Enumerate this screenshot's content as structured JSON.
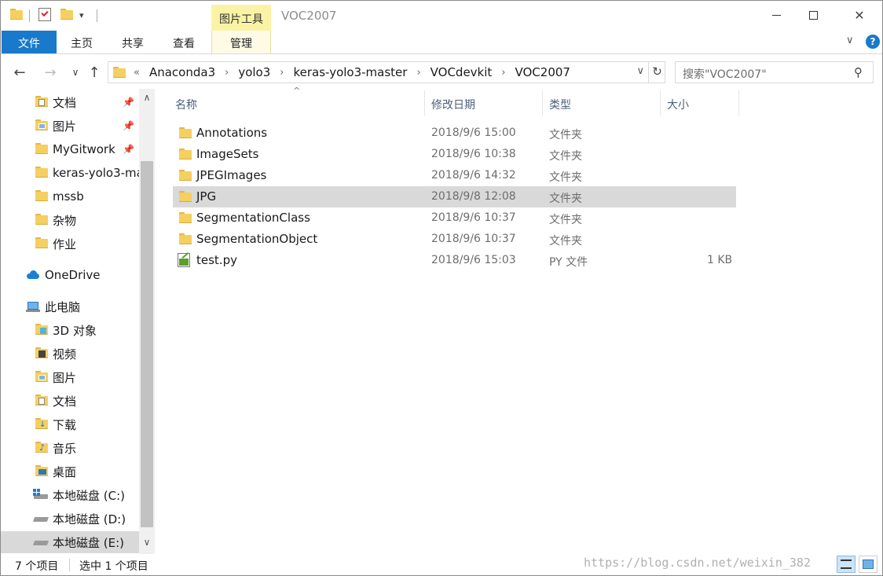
{
  "window": {
    "title": "VOC2007",
    "context_tab_group": "图片工具"
  },
  "ribbon": {
    "tabs": [
      {
        "label": "文件"
      },
      {
        "label": "主页"
      },
      {
        "label": "共享"
      },
      {
        "label": "查看"
      },
      {
        "label": "管理"
      }
    ]
  },
  "address": {
    "overflow": "«",
    "crumbs": [
      "Anaconda3",
      "yolo3",
      "keras-yolo3-master",
      "VOCdevkit",
      "VOC2007"
    ]
  },
  "search": {
    "placeholder": "搜索\"VOC2007\""
  },
  "sidebar": {
    "items": [
      {
        "label": "文档",
        "icon": "documents-icon",
        "pinned": true
      },
      {
        "label": "图片",
        "icon": "pictures-icon",
        "pinned": true
      },
      {
        "label": "MyGitwork",
        "icon": "folder-icon",
        "pinned": true
      },
      {
        "label": "keras-yolo3-ma",
        "icon": "folder-icon"
      },
      {
        "label": "mssb",
        "icon": "folder-icon"
      },
      {
        "label": "杂物",
        "icon": "folder-icon"
      },
      {
        "label": "作业",
        "icon": "folder-icon"
      },
      {
        "label": "OneDrive",
        "icon": "onedrive-icon"
      },
      {
        "label": "此电脑",
        "icon": "this-pc-icon"
      },
      {
        "label": "3D 对象",
        "icon": "3d-objects-icon"
      },
      {
        "label": "视频",
        "icon": "videos-icon"
      },
      {
        "label": "图片",
        "icon": "pictures-icon"
      },
      {
        "label": "文档",
        "icon": "documents-icon"
      },
      {
        "label": "下载",
        "icon": "downloads-icon"
      },
      {
        "label": "音乐",
        "icon": "music-icon"
      },
      {
        "label": "桌面",
        "icon": "desktop-icon"
      },
      {
        "label": "本地磁盘 (C:)",
        "icon": "drive-c-icon"
      },
      {
        "label": "本地磁盘 (D:)",
        "icon": "drive-icon"
      },
      {
        "label": "本地磁盘 (E:)",
        "icon": "drive-icon",
        "selected": true
      }
    ]
  },
  "columns": {
    "name": "名称",
    "date": "修改日期",
    "type": "类型",
    "size": "大小"
  },
  "files": [
    {
      "name": "Annotations",
      "date": "2018/9/6 15:00",
      "type": "文件夹",
      "size": "",
      "icon": "folder-icon"
    },
    {
      "name": "ImageSets",
      "date": "2018/9/6 10:38",
      "type": "文件夹",
      "size": "",
      "icon": "folder-icon"
    },
    {
      "name": "JPEGImages",
      "date": "2018/9/6 14:32",
      "type": "文件夹",
      "size": "",
      "icon": "folder-icon"
    },
    {
      "name": "JPG",
      "date": "2018/9/8 12:08",
      "type": "文件夹",
      "size": "",
      "icon": "folder-icon",
      "selected": true
    },
    {
      "name": "SegmentationClass",
      "date": "2018/9/6 10:37",
      "type": "文件夹",
      "size": "",
      "icon": "folder-icon"
    },
    {
      "name": "SegmentationObject",
      "date": "2018/9/6 10:37",
      "type": "文件夹",
      "size": "",
      "icon": "folder-icon"
    },
    {
      "name": "test.py",
      "date": "2018/9/6 15:03",
      "type": "PY 文件",
      "size": "1 KB",
      "icon": "python-file-icon"
    }
  ],
  "status": {
    "item_count": "7 个项目",
    "selection": "选中 1 个项目"
  },
  "watermark": "https://blog.csdn.net/weixin_382",
  "colors": {
    "accent": "#1979ca",
    "context_tab": "#faf3a5",
    "selection": "#d9d9d9",
    "folder": "#f5cf5f"
  }
}
